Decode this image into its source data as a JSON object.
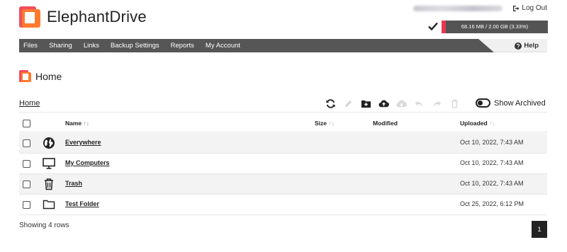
{
  "app": {
    "brand": "ElephantDrive",
    "logout_label": "Log Out",
    "storage": {
      "text": "68.16 MB / 2.00 GB (3.33%)",
      "fraction_used": 0.0333
    }
  },
  "nav": {
    "items": [
      {
        "label": "Files"
      },
      {
        "label": "Sharing"
      },
      {
        "label": "Links"
      },
      {
        "label": "Backup Settings"
      },
      {
        "label": "Reports"
      },
      {
        "label": "My Account"
      }
    ],
    "help_label": "Help"
  },
  "page": {
    "title": "Home"
  },
  "breadcrumb": {
    "label": "Home"
  },
  "toolbar": {
    "show_archived_label": "Show Archived",
    "icons": [
      "refresh-icon",
      "edit-icon",
      "new-folder-icon",
      "upload-icon",
      "download-icon",
      "undo-icon",
      "redo-icon",
      "delete-icon"
    ]
  },
  "table": {
    "columns": {
      "name": "Name",
      "name_sort": "↑↓",
      "size": "Size",
      "size_sort": "↑↓",
      "modified": "Modified",
      "uploaded": "Uploaded",
      "uploaded_sort": "↑↓"
    },
    "rows": [
      {
        "icon": "globe-icon",
        "name": "Everywhere",
        "uploaded": "Oct 10, 2022, 7:43 AM"
      },
      {
        "icon": "monitor-icon",
        "name": "My Computers",
        "uploaded": "Oct 10, 2022, 7:43 AM"
      },
      {
        "icon": "trash-icon",
        "name": "Trash",
        "uploaded": "Oct 10, 2022, 7:43 AM"
      },
      {
        "icon": "folder-icon",
        "name": "Test Folder",
        "uploaded": "Oct 25, 2022, 6:12 PM"
      }
    ]
  },
  "footer": {
    "rows_text": "Showing 4 rows",
    "page_number": "1"
  },
  "colors": {
    "accent": "#e8384f",
    "nav_bg": "#565656",
    "storage_bg": "#545454"
  }
}
